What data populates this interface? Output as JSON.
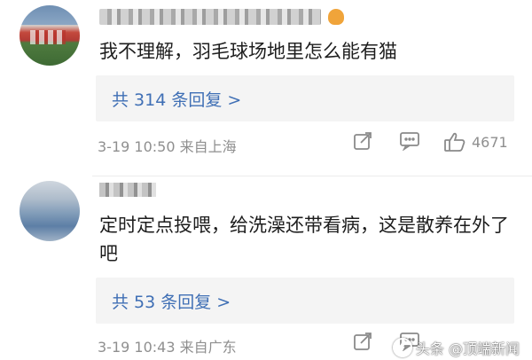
{
  "comments": [
    {
      "text": "我不理解，羽毛球场地里怎么能有猫",
      "reply_label": "共 314 条回复 >",
      "date": "3-19",
      "time": "10:50",
      "location": "来自上海",
      "likes": "4671"
    },
    {
      "text": "定时定点投喂，给洗澡还带看病，这是散养在外了吧",
      "reply_label": "共 53 条回复 >",
      "date": "3-19",
      "time": "10:43",
      "location": "来自广东"
    }
  ],
  "watermark": {
    "text": "头条 @顶端新闻"
  },
  "icons": {
    "share": "share-icon",
    "comment": "comment-icon",
    "like": "thumbs-up-icon",
    "badge": "crown-badge-icon"
  }
}
